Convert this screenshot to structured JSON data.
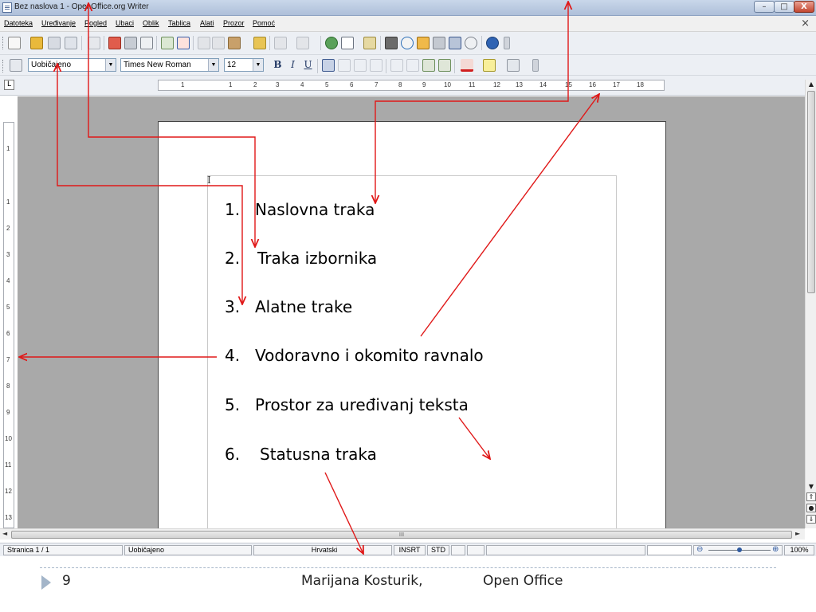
{
  "window": {
    "title": "Bez naslova 1 - OpenOffice.org Writer",
    "minimize_label": "–",
    "maximize_label": "□",
    "close_label": "X",
    "doc_close_label": "×"
  },
  "menu": {
    "items": [
      "Datoteka",
      "Uređivanje",
      "Pogled",
      "Ubaci",
      "Oblik",
      "Tablica",
      "Alati",
      "Prozor",
      "Pomoć"
    ]
  },
  "formatting": {
    "style": "Uobičajeno",
    "font": "Times New Roman",
    "size": "12",
    "bold": "B",
    "italic": "I",
    "underline": "U"
  },
  "ruler": {
    "tabstop_glyph": "L",
    "h_labels": [
      "1",
      "1",
      "2",
      "3",
      "4",
      "5",
      "6",
      "7",
      "8",
      "9",
      "10",
      "11",
      "12",
      "13",
      "14",
      "15",
      "16",
      "17",
      "18"
    ],
    "v_labels": [
      "1",
      "1",
      "2",
      "3",
      "4",
      "5",
      "6",
      "7",
      "8",
      "9",
      "10",
      "11",
      "12",
      "13"
    ]
  },
  "document": {
    "cursor_glyph": "I",
    "items": [
      {
        "number": "1.",
        "text": "Naslovna traka"
      },
      {
        "number": "2.",
        "text": "Traka izbornika"
      },
      {
        "number": "3.",
        "text": "Alatne trake"
      },
      {
        "number": "4.",
        "text": "Vodoravno i okomito ravnalo"
      },
      {
        "number": "5.",
        "text": "Prostor za uređivanj teksta"
      },
      {
        "number": "6.",
        "text": "Statusna traka"
      }
    ]
  },
  "scrollbar": {
    "up_glyph": "▲",
    "down_glyph": "▼",
    "left_glyph": "◄",
    "right_glyph": "►",
    "hthumb_grip": "III"
  },
  "statusbar": {
    "page": "Stranica 1 / 1",
    "style": "Uobičajeno",
    "language": "Hrvatski",
    "insert_mode": "INSRT",
    "selection_mode": "STD",
    "zoom": "100%"
  },
  "footer": {
    "page_number": "9",
    "author": "Marijana Kosturik,",
    "subject": "Open Office"
  },
  "colors": {
    "annotation": "#e01818",
    "workspace": "#a9a9a9"
  }
}
